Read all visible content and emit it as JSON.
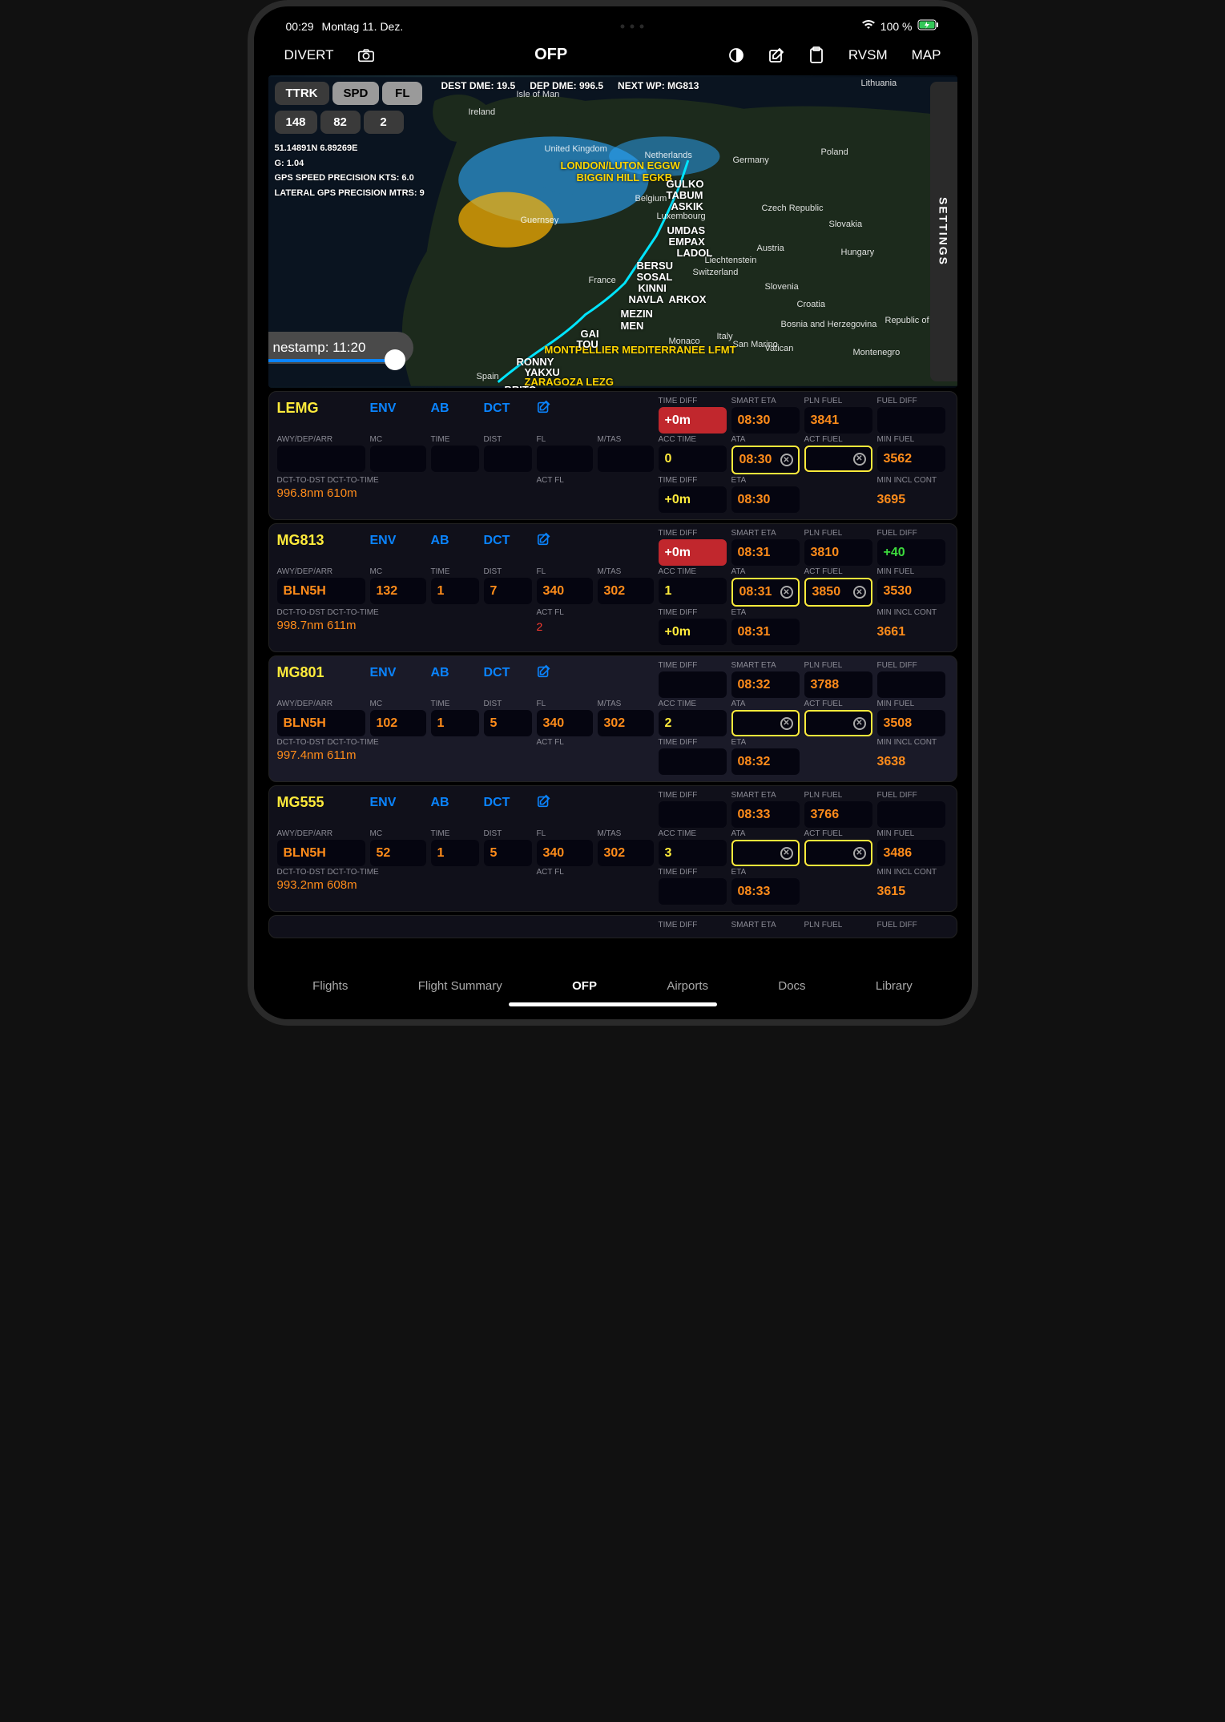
{
  "status": {
    "time": "00:29",
    "date": "Montag 11. Dez.",
    "battery": "100 %"
  },
  "topbar": {
    "divert": "DIVERT",
    "ofp": "OFP",
    "rvsm": "RVSM",
    "map": "MAP"
  },
  "pillHeaders": {
    "ttrk": "TTRK",
    "spd": "SPD",
    "fl": "FL"
  },
  "pillValues": {
    "ttrk": "148",
    "spd": "82",
    "fl": "2"
  },
  "mapInfo": {
    "destDme": "DEST DME: 19.5",
    "depDme": "DEP DME: 996.5",
    "nextWp": "NEXT WP: MG813"
  },
  "mapMetrics": {
    "pos": "51.14891N 6.89269E",
    "g": "G: 1.04",
    "gps": "GPS SPEED PRECISION KTS: 6.0",
    "lat": "LATERAL GPS PRECISION MTRS: 9"
  },
  "countries": {
    "ireland": "Ireland",
    "uk": "United Kingdom",
    "neth": "Netherlands",
    "germany": "Germany",
    "poland": "Poland",
    "belgium": "Belgium",
    "lux": "Luxembourg",
    "czech": "Czech Republic",
    "slovakia": "Slovakia",
    "austria": "Austria",
    "hungary": "Hungary",
    "slovenia": "Slovenia",
    "croatia": "Croatia",
    "bosnia": "Bosnia and Herzegovina",
    "serbia": "Republic of S",
    "france": "France",
    "switz": "Switzerland",
    "liech": "Liechtenstein",
    "italy": "Italy",
    "sanmarino": "San Marino",
    "vatican": "Vatican",
    "monaco": "Monaco",
    "spain": "Spain",
    "montenegro": "Montenegro",
    "lithuania": "Lithuania",
    "isleofman": "Isle of Man",
    "guernsey": "Guernsey"
  },
  "airports": {
    "eggw": "LONDON/LUTON EGGW",
    "egkb": "BIGGIN HILL EGKB",
    "lfmt": "MONTPELLIER MEDITERRANEE LFMT",
    "lezg": "ZARAGOZA LEZG"
  },
  "route": {
    "gulko": "GULKO",
    "tabum": "TABUM",
    "askik": "ASKIK",
    "umdas": "UMDAS",
    "empax": "EMPAX",
    "ladol": "LADOL",
    "bersu": "BERSU",
    "sosal": "SOSAL",
    "kinni": "KINNI",
    "navla": "NAVLA",
    "arkox": "ARKOX",
    "mezin": "MEZIN",
    "men": "MEN",
    "gai": "GAI",
    "tou": "TOU",
    "ronny": "RONNY",
    "yakxu": "YAKXU",
    "brito": "BRITO"
  },
  "settings": "SETTINGS",
  "timestamp": "nestamp: 11:20",
  "colHeaders": {
    "awy": "AWY/DEP/ARR",
    "mc": "MC",
    "time": "TIME",
    "dist": "DIST",
    "fl": "FL",
    "mtas": "M/TAS",
    "actfl": "ACT FL",
    "timediff": "TIME DIFF",
    "acctime": "ACC TIME",
    "smarteta": "SMART ETA",
    "ata": "ATA",
    "eta": "ETA",
    "plnfuel": "PLN FUEL",
    "actfuel": "ACT FUEL",
    "fueldiff": "FUEL DIFF",
    "minfuel": "MIN FUEL",
    "mininclcont": "MIN INCL CONT",
    "dctdst": "DCT-TO-DST DCT-TO-TIME"
  },
  "links": {
    "env": "ENV",
    "ab": "AB",
    "dct": "DCT"
  },
  "rows": [
    {
      "name": "LEMG",
      "awy": "",
      "mc": "",
      "time": "",
      "dist": "",
      "fl": "",
      "mtas": "",
      "actfl": "",
      "timediff1": "+0m",
      "acctime": "0",
      "timediff2": "+0m",
      "smarteta": "08:30",
      "ata": "08:30",
      "eta": "08:30",
      "plnfuel": "3841",
      "actfuel": "",
      "fueldiff": "",
      "minfuel": "3562",
      "mincont": "3695",
      "dctinfo": "996.8nm 610m",
      "timediff1_red": true,
      "ata_outlined": true,
      "actfuel_outlined": true,
      "active": false
    },
    {
      "name": "MG813",
      "awy": "BLN5H",
      "mc": "132",
      "time": "1",
      "dist": "7",
      "fl": "340",
      "mtas": "302",
      "actfl": "2",
      "timediff1": "+0m",
      "acctime": "1",
      "timediff2": "+0m",
      "smarteta": "08:31",
      "ata": "08:31",
      "eta": "08:31",
      "plnfuel": "3810",
      "actfuel": "3850",
      "fueldiff": "+40",
      "minfuel": "3530",
      "mincont": "3661",
      "dctinfo": "998.7nm 611m",
      "timediff1_red": true,
      "ata_outlined": true,
      "actfuel_outlined": true,
      "fueldiff_green": true,
      "active": false
    },
    {
      "name": "MG801",
      "awy": "BLN5H",
      "mc": "102",
      "time": "1",
      "dist": "5",
      "fl": "340",
      "mtas": "302",
      "actfl": "",
      "timediff1": "",
      "acctime": "2",
      "timediff2": "",
      "smarteta": "08:32",
      "ata": "",
      "eta": "08:32",
      "plnfuel": "3788",
      "actfuel": "",
      "fueldiff": "",
      "minfuel": "3508",
      "mincont": "3638",
      "dctinfo": "997.4nm 611m",
      "ata_outlined": true,
      "actfuel_outlined": true,
      "active": true
    },
    {
      "name": "MG555",
      "awy": "BLN5H",
      "mc": "52",
      "time": "1",
      "dist": "5",
      "fl": "340",
      "mtas": "302",
      "actfl": "",
      "timediff1": "",
      "acctime": "3",
      "timediff2": "",
      "smarteta": "08:33",
      "ata": "",
      "eta": "08:33",
      "plnfuel": "3766",
      "actfuel": "",
      "fueldiff": "",
      "minfuel": "3486",
      "mincont": "3615",
      "dctinfo": "993.2nm 608m",
      "ata_outlined": true,
      "actfuel_outlined": true,
      "active": false
    }
  ],
  "peekHeaders": {
    "timediff": "TIME DIFF",
    "smarteta": "SMART ETA",
    "plnfuel": "PLN FUEL",
    "fueldiff": "FUEL DIFF"
  },
  "tabs": {
    "flights": "Flights",
    "summary": "Flight Summary",
    "ofp": "OFP",
    "airports": "Airports",
    "docs": "Docs",
    "library": "Library"
  }
}
